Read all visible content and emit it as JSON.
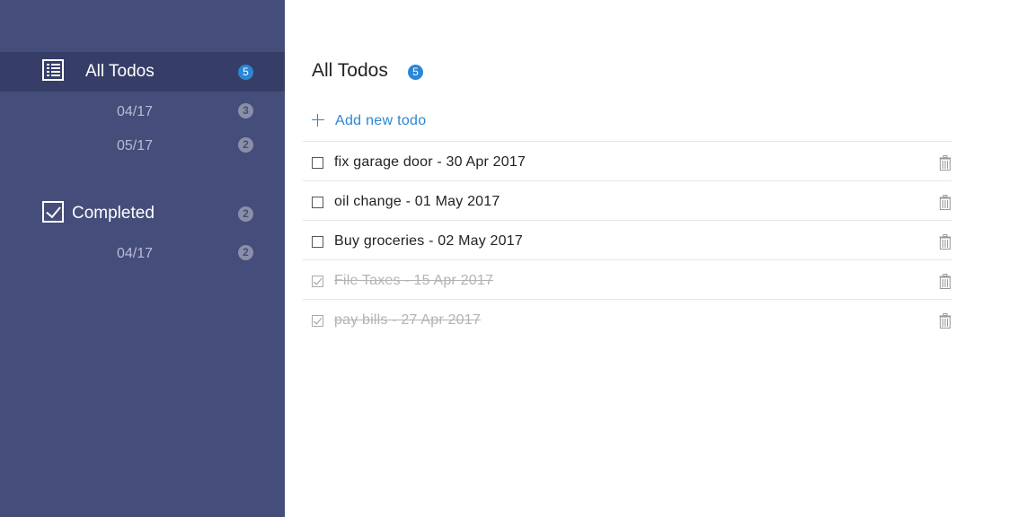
{
  "sidebar": {
    "all_todos": {
      "label": "All Todos",
      "count": "5",
      "icon": "list-icon",
      "subitems": [
        {
          "label": "04/17",
          "count": "3"
        },
        {
          "label": "05/17",
          "count": "2"
        }
      ]
    },
    "completed": {
      "label": "Completed",
      "count": "2",
      "icon": "checkbox-icon",
      "subitems": [
        {
          "label": "04/17",
          "count": "2"
        }
      ]
    }
  },
  "main": {
    "title": "All Todos",
    "count": "5",
    "add_label": "Add new todo",
    "todos": [
      {
        "text": "fix garage door - 30 Apr 2017",
        "completed": false
      },
      {
        "text": "oil change - 01 May 2017",
        "completed": false
      },
      {
        "text": "Buy groceries - 02 May 2017",
        "completed": false
      },
      {
        "text": "File Taxes - 15 Apr 2017",
        "completed": true
      },
      {
        "text": "pay bills - 27 Apr 2017",
        "completed": true
      }
    ]
  },
  "colors": {
    "sidebar_bg": "#454d7a",
    "sidebar_active_bg": "#363e67",
    "accent": "#2b86d6",
    "completed_text": "#b3b3b3"
  }
}
